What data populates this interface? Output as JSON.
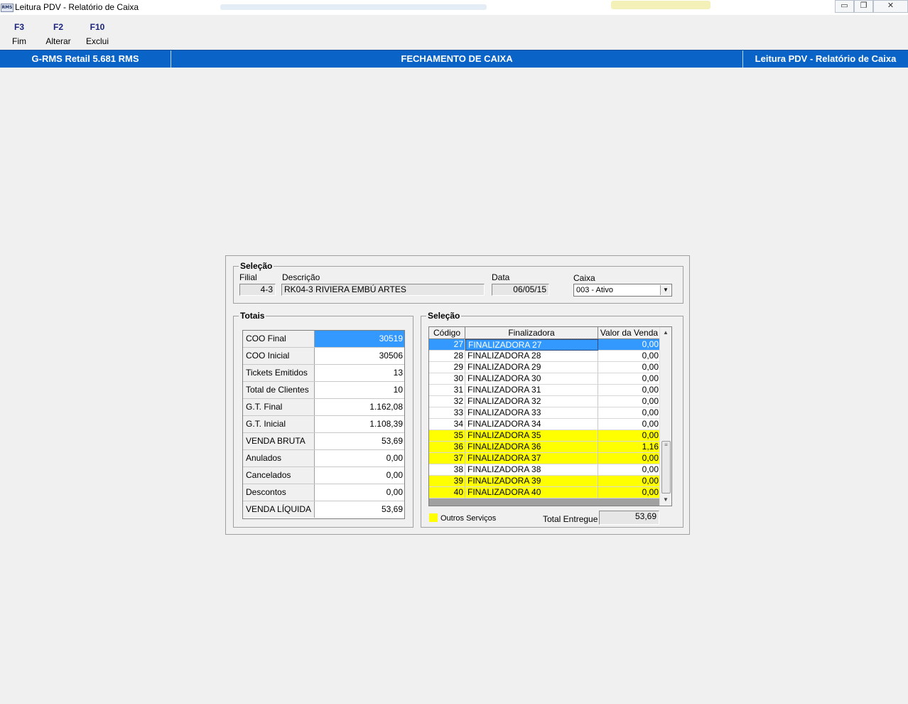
{
  "window": {
    "title": "Leitura PDV - Relatório de Caixa",
    "icon_text": "RMS"
  },
  "toolbar": {
    "keys": [
      {
        "key": "F3",
        "label": "Fim"
      },
      {
        "key": "F2",
        "label": "Alterar"
      },
      {
        "key": "F10",
        "label": "Exclui"
      }
    ]
  },
  "header_bar": {
    "left": "G-RMS Retail 5.681 RMS",
    "center": "FECHAMENTO DE CAIXA",
    "right": "Leitura PDV - Relatório de Caixa"
  },
  "selecao_top": {
    "title": "Seleção",
    "filial_label": "Filial",
    "filial_value": "4-3",
    "descricao_label": "Descrição",
    "descricao_value": "RK04-3 RIVIERA EMBÚ ARTES",
    "data_label": "Data",
    "data_value": "06/05/15",
    "caixa_label": "Caixa",
    "caixa_value": "003 - Ativo"
  },
  "totais": {
    "title": "Totais",
    "rows": [
      {
        "label": "COO Final",
        "value": "30519"
      },
      {
        "label": "COO Inicial",
        "value": "30506"
      },
      {
        "label": "Tickets Emitidos",
        "value": "13"
      },
      {
        "label": "Total de Clientes",
        "value": "10"
      },
      {
        "label": "G.T. Final",
        "value": "1.162,08"
      },
      {
        "label": "G.T. Inicial",
        "value": "1.108,39"
      },
      {
        "label": "VENDA BRUTA",
        "value": "53,69"
      },
      {
        "label": "Anulados",
        "value": "0,00"
      },
      {
        "label": "Cancelados",
        "value": "0,00"
      },
      {
        "label": "Descontos",
        "value": "0,00"
      },
      {
        "label": "VENDA LÍQUIDA",
        "value": "53,69"
      }
    ]
  },
  "selecao_grid": {
    "title": "Seleção",
    "headers": {
      "codigo": "Código",
      "finalizadora": "Finalizadora",
      "valor": "Valor da Venda"
    },
    "rows": [
      {
        "codigo": "27",
        "finalizadora": "FINALIZADORA 27",
        "valor": "0,00",
        "highlight": false,
        "selected": true
      },
      {
        "codigo": "28",
        "finalizadora": "FINALIZADORA 28",
        "valor": "0,00",
        "highlight": false,
        "selected": false
      },
      {
        "codigo": "29",
        "finalizadora": "FINALIZADORA 29",
        "valor": "0,00",
        "highlight": false,
        "selected": false
      },
      {
        "codigo": "30",
        "finalizadora": "FINALIZADORA 30",
        "valor": "0,00",
        "highlight": false,
        "selected": false
      },
      {
        "codigo": "31",
        "finalizadora": "FINALIZADORA 31",
        "valor": "0,00",
        "highlight": false,
        "selected": false
      },
      {
        "codigo": "32",
        "finalizadora": "FINALIZADORA 32",
        "valor": "0,00",
        "highlight": false,
        "selected": false
      },
      {
        "codigo": "33",
        "finalizadora": "FINALIZADORA 33",
        "valor": "0,00",
        "highlight": false,
        "selected": false
      },
      {
        "codigo": "34",
        "finalizadora": "FINALIZADORA 34",
        "valor": "0,00",
        "highlight": false,
        "selected": false
      },
      {
        "codigo": "35",
        "finalizadora": "FINALIZADORA 35",
        "valor": "0,00",
        "highlight": true,
        "selected": false
      },
      {
        "codigo": "36",
        "finalizadora": "FINALIZADORA 36",
        "valor": "1,16",
        "highlight": true,
        "selected": false
      },
      {
        "codigo": "37",
        "finalizadora": "FINALIZADORA 37",
        "valor": "0,00",
        "highlight": true,
        "selected": false
      },
      {
        "codigo": "38",
        "finalizadora": "FINALIZADORA 38",
        "valor": "0,00",
        "highlight": false,
        "selected": false
      },
      {
        "codigo": "39",
        "finalizadora": "FINALIZADORA 39",
        "valor": "0,00",
        "highlight": true,
        "selected": false
      },
      {
        "codigo": "40",
        "finalizadora": "FINALIZADORA 40",
        "valor": "0,00",
        "highlight": true,
        "selected": false
      }
    ],
    "legend_label": "Outros Serviços",
    "legend_color": "#ffff00",
    "total_label": "Total Entregue",
    "total_value": "53,69"
  },
  "colors": {
    "header_bar": "#0a64c8",
    "selection": "#3399ff",
    "highlight": "#ffff00"
  }
}
